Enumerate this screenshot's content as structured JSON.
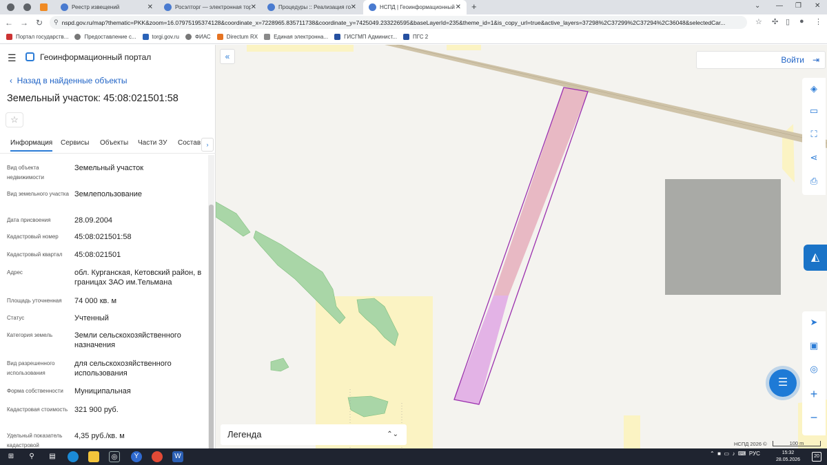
{
  "browser": {
    "tabs": [
      {
        "title": "",
        "active": false
      },
      {
        "title": "",
        "active": false
      },
      {
        "title": "",
        "active": false
      },
      {
        "title": "Реестр извещений",
        "active": false
      },
      {
        "title": "Росэлторг — электронная торго...",
        "active": false
      },
      {
        "title": "Процедуры :: Реализация госим...",
        "active": false
      },
      {
        "title": "НСПД | Геоинформационный п...",
        "active": true
      }
    ],
    "url": "nspd.gov.ru/map?thematic=PKK&zoom=16.07975195374128&coordinate_x=7228965.835711738&coordinate_y=7425049.233226595&baseLayerId=235&theme_id=1&is_copy_url=true&active_layers=37298%2C37299%2C37294%2C36048&selectedCar...",
    "bookmarks": [
      "Портал государств...",
      "Предоставление с...",
      "torgi.gov.ru",
      "ФИАС",
      "Directum RX",
      "Единая электронна...",
      "ГИСГМП Админист...",
      "ПГС 2"
    ]
  },
  "app": {
    "title": "Геоинформационный портал",
    "back_label": "Назад в найденные объекты",
    "object_title": "Земельный участок: 45:08:021501:58",
    "tabs": [
      "Информация",
      "Сервисы",
      "Объекты",
      "Части ЗУ",
      "Состав"
    ],
    "properties": [
      {
        "key": "Вид объекта недвижимости",
        "value": "Земельный участок"
      },
      {
        "key": "Вид земельного участка",
        "value": "Землепользование"
      },
      {
        "key": "Дата присвоения",
        "value": "28.09.2004"
      },
      {
        "key": "Кадастровый номер",
        "value": "45:08:021501:58"
      },
      {
        "key": "Кадастровый квартал",
        "value": "45:08:021501"
      },
      {
        "key": "Адрес",
        "value": "обл. Курганская, Кетовский район, в границах ЗАО им.Тельмана"
      },
      {
        "key": "Площадь уточненная",
        "value": "74 000 кв. м"
      },
      {
        "key": "Статус",
        "value": "Учтенный"
      },
      {
        "key": "Категория земель",
        "value": "Земли сельскохозяйственного назначения"
      },
      {
        "key": "Вид разрешенного использования",
        "value": "для сельскохозяйственного использования"
      },
      {
        "key": "Форма собственности",
        "value": "Муниципальная"
      },
      {
        "key": "Кадастровая стоимость",
        "value": "321 900 руб."
      },
      {
        "key": "Удельный показатель кадастровой",
        "value": "4,35 руб./кв. м"
      }
    ]
  },
  "map": {
    "login_label": "Войти",
    "legend_label": "Легенда",
    "copyright": "НСПД 2026 ©",
    "scale_label": "100 m",
    "colors": {
      "parcel_stroke": "#9b2fae",
      "parcel_fill_upper": "#e8b9c4",
      "parcel_fill_lower": "#e3b3e6",
      "fields": "#fbf3c3",
      "forest": "#a9d6a7",
      "road": "#cfc3a8"
    }
  },
  "taskbar": {
    "lang": "РУС",
    "time": "15:32",
    "date": "28.05.2026",
    "notif": "20"
  }
}
